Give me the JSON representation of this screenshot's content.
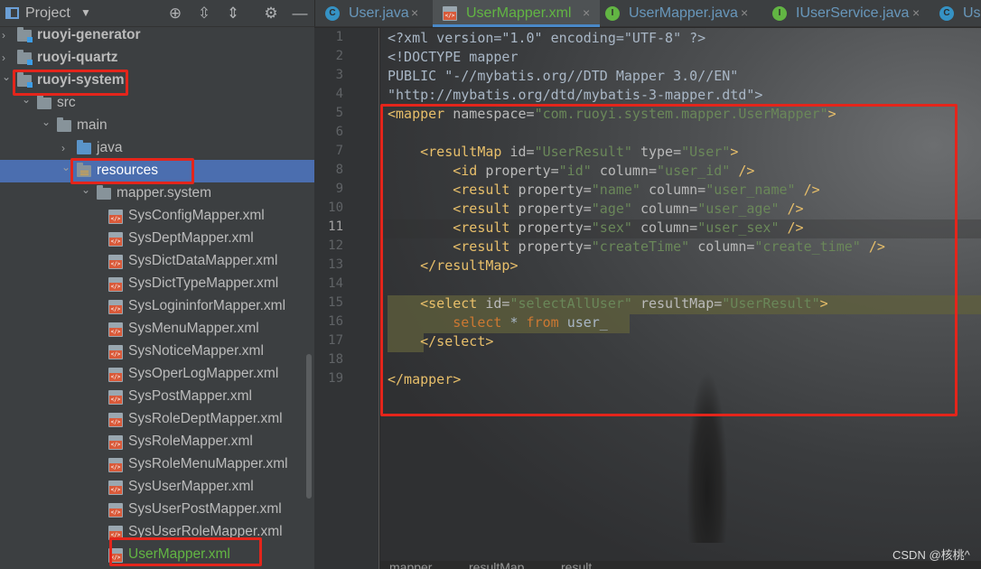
{
  "project_panel": {
    "title": "Project",
    "tree": [
      {
        "label": "ruoyi-generator",
        "level": 0,
        "kind": "module"
      },
      {
        "label": "ruoyi-quartz",
        "level": 0,
        "kind": "module"
      },
      {
        "label": "ruoyi-system",
        "level": 0,
        "kind": "module",
        "expanded": true,
        "highlighted": true
      },
      {
        "label": "src",
        "level": 1,
        "kind": "folder",
        "expanded": true
      },
      {
        "label": "main",
        "level": 2,
        "kind": "folder",
        "expanded": true
      },
      {
        "label": "java",
        "level": 3,
        "kind": "source-folder",
        "expanded": false
      },
      {
        "label": "resources",
        "level": 3,
        "kind": "resources-folder",
        "expanded": true,
        "selected": true,
        "highlighted": true
      },
      {
        "label": "mapper.system",
        "level": 4,
        "kind": "folder",
        "expanded": true
      },
      {
        "label": "SysConfigMapper.xml",
        "level": 5,
        "kind": "xml"
      },
      {
        "label": "SysDeptMapper.xml",
        "level": 5,
        "kind": "xml"
      },
      {
        "label": "SysDictDataMapper.xml",
        "level": 5,
        "kind": "xml"
      },
      {
        "label": "SysDictTypeMapper.xml",
        "level": 5,
        "kind": "xml"
      },
      {
        "label": "SysLogininforMapper.xml",
        "level": 5,
        "kind": "xml"
      },
      {
        "label": "SysMenuMapper.xml",
        "level": 5,
        "kind": "xml"
      },
      {
        "label": "SysNoticeMapper.xml",
        "level": 5,
        "kind": "xml"
      },
      {
        "label": "SysOperLogMapper.xml",
        "level": 5,
        "kind": "xml"
      },
      {
        "label": "SysPostMapper.xml",
        "level": 5,
        "kind": "xml"
      },
      {
        "label": "SysRoleDeptMapper.xml",
        "level": 5,
        "kind": "xml"
      },
      {
        "label": "SysRoleMapper.xml",
        "level": 5,
        "kind": "xml"
      },
      {
        "label": "SysRoleMenuMapper.xml",
        "level": 5,
        "kind": "xml"
      },
      {
        "label": "SysUserMapper.xml",
        "level": 5,
        "kind": "xml"
      },
      {
        "label": "SysUserPostMapper.xml",
        "level": 5,
        "kind": "xml"
      },
      {
        "label": "SysUserRoleMapper.xml",
        "level": 5,
        "kind": "xml"
      },
      {
        "label": "UserMapper.xml",
        "level": 5,
        "kind": "xml",
        "new_file": true,
        "highlighted": true
      }
    ]
  },
  "tabs": [
    {
      "label": "User.java",
      "icon": "class-icon",
      "active": false
    },
    {
      "label": "UserMapper.xml",
      "icon": "xml-file-icon",
      "active": true
    },
    {
      "label": "UserMapper.java",
      "icon": "interface-icon",
      "active": false
    },
    {
      "label": "IUserService.java",
      "icon": "interface-icon",
      "active": false
    },
    {
      "label": "Us",
      "icon": "class-icon",
      "active": false
    }
  ],
  "editor": {
    "current_line": 11,
    "line_numbers": [
      "1",
      "2",
      "3",
      "4",
      "5",
      "6",
      "7",
      "8",
      "9",
      "10",
      "11",
      "12",
      "13",
      "14",
      "15",
      "16",
      "17",
      "18",
      "19"
    ],
    "lines": [
      [
        [
          "t-pl",
          "<?xml version=\"1.0\" encoding=\"UTF-8\" ?>"
        ]
      ],
      [
        [
          "t-pl",
          "<!DOCTYPE mapper"
        ]
      ],
      [
        [
          "t-pl",
          "PUBLIC \"-//mybatis.org//DTD Mapper 3.0//EN\""
        ]
      ],
      [
        [
          "t-pl",
          "\"http://mybatis.org/dtd/mybatis-3-mapper.dtd\">"
        ]
      ],
      [
        [
          "t-tag",
          "<mapper "
        ],
        [
          "t-attr",
          "namespace="
        ],
        [
          "t-str",
          "\"com.ruoyi.system.mapper.UserMapper\""
        ],
        [
          "t-tag",
          ">"
        ]
      ],
      [],
      [
        [
          "t-pl",
          "    "
        ],
        [
          "t-tag",
          "<resultMap "
        ],
        [
          "t-attr",
          "id="
        ],
        [
          "t-str",
          "\"UserResult\" "
        ],
        [
          "t-attr",
          "type="
        ],
        [
          "t-str",
          "\"User\""
        ],
        [
          "t-tag",
          ">"
        ]
      ],
      [
        [
          "t-pl",
          "        "
        ],
        [
          "t-tag",
          "<id "
        ],
        [
          "t-attr",
          "property="
        ],
        [
          "t-str",
          "\"id\" "
        ],
        [
          "t-attr",
          "column="
        ],
        [
          "t-str",
          "\"user_id\" "
        ],
        [
          "t-tag",
          "/>"
        ]
      ],
      [
        [
          "t-pl",
          "        "
        ],
        [
          "t-tag",
          "<result "
        ],
        [
          "t-attr",
          "property="
        ],
        [
          "t-str",
          "\"name\" "
        ],
        [
          "t-attr",
          "column="
        ],
        [
          "t-str",
          "\"user_name\" "
        ],
        [
          "t-tag",
          "/>"
        ]
      ],
      [
        [
          "t-pl",
          "        "
        ],
        [
          "t-tag",
          "<result "
        ],
        [
          "t-attr",
          "property="
        ],
        [
          "t-str",
          "\"age\" "
        ],
        [
          "t-attr",
          "column="
        ],
        [
          "t-str",
          "\"user_age\" "
        ],
        [
          "t-tag",
          "/>"
        ]
      ],
      [
        [
          "t-pl",
          "        "
        ],
        [
          "t-tag",
          "<result "
        ],
        [
          "t-attr",
          "property="
        ],
        [
          "t-str",
          "\"sex\" "
        ],
        [
          "t-attr",
          "column="
        ],
        [
          "t-str",
          "\"user_sex\" "
        ],
        [
          "t-tag",
          "/>"
        ]
      ],
      [
        [
          "t-pl",
          "        "
        ],
        [
          "t-tag",
          "<result "
        ],
        [
          "t-attr",
          "property="
        ],
        [
          "t-str",
          "\"createTime\" "
        ],
        [
          "t-attr",
          "column="
        ],
        [
          "t-str",
          "\"create_time\" "
        ],
        [
          "t-tag",
          "/>"
        ]
      ],
      [
        [
          "t-pl",
          "    "
        ],
        [
          "t-tag",
          "</resultMap>"
        ]
      ],
      [],
      [
        [
          "t-pl",
          "    "
        ],
        [
          "t-tag",
          "<select "
        ],
        [
          "t-attr",
          "id="
        ],
        [
          "t-str",
          "\"selectAllUser\" "
        ],
        [
          "t-attr",
          "resultMap="
        ],
        [
          "t-str",
          "\"UserResult\""
        ],
        [
          "t-tag",
          ">"
        ]
      ],
      [
        [
          "t-pl",
          "        "
        ],
        [
          "t-kw",
          "select "
        ],
        [
          "t-pl",
          "* "
        ],
        [
          "t-kw",
          "from "
        ],
        [
          "t-pl",
          "user_"
        ]
      ],
      [
        [
          "t-pl",
          "    "
        ],
        [
          "t-tag",
          "</select>"
        ]
      ],
      [],
      [
        [
          "t-tag",
          "</mapper>"
        ]
      ]
    ]
  },
  "breadcrumb": [
    "mapper",
    "resultMap",
    "result"
  ],
  "watermark": "CSDN @核桃^"
}
